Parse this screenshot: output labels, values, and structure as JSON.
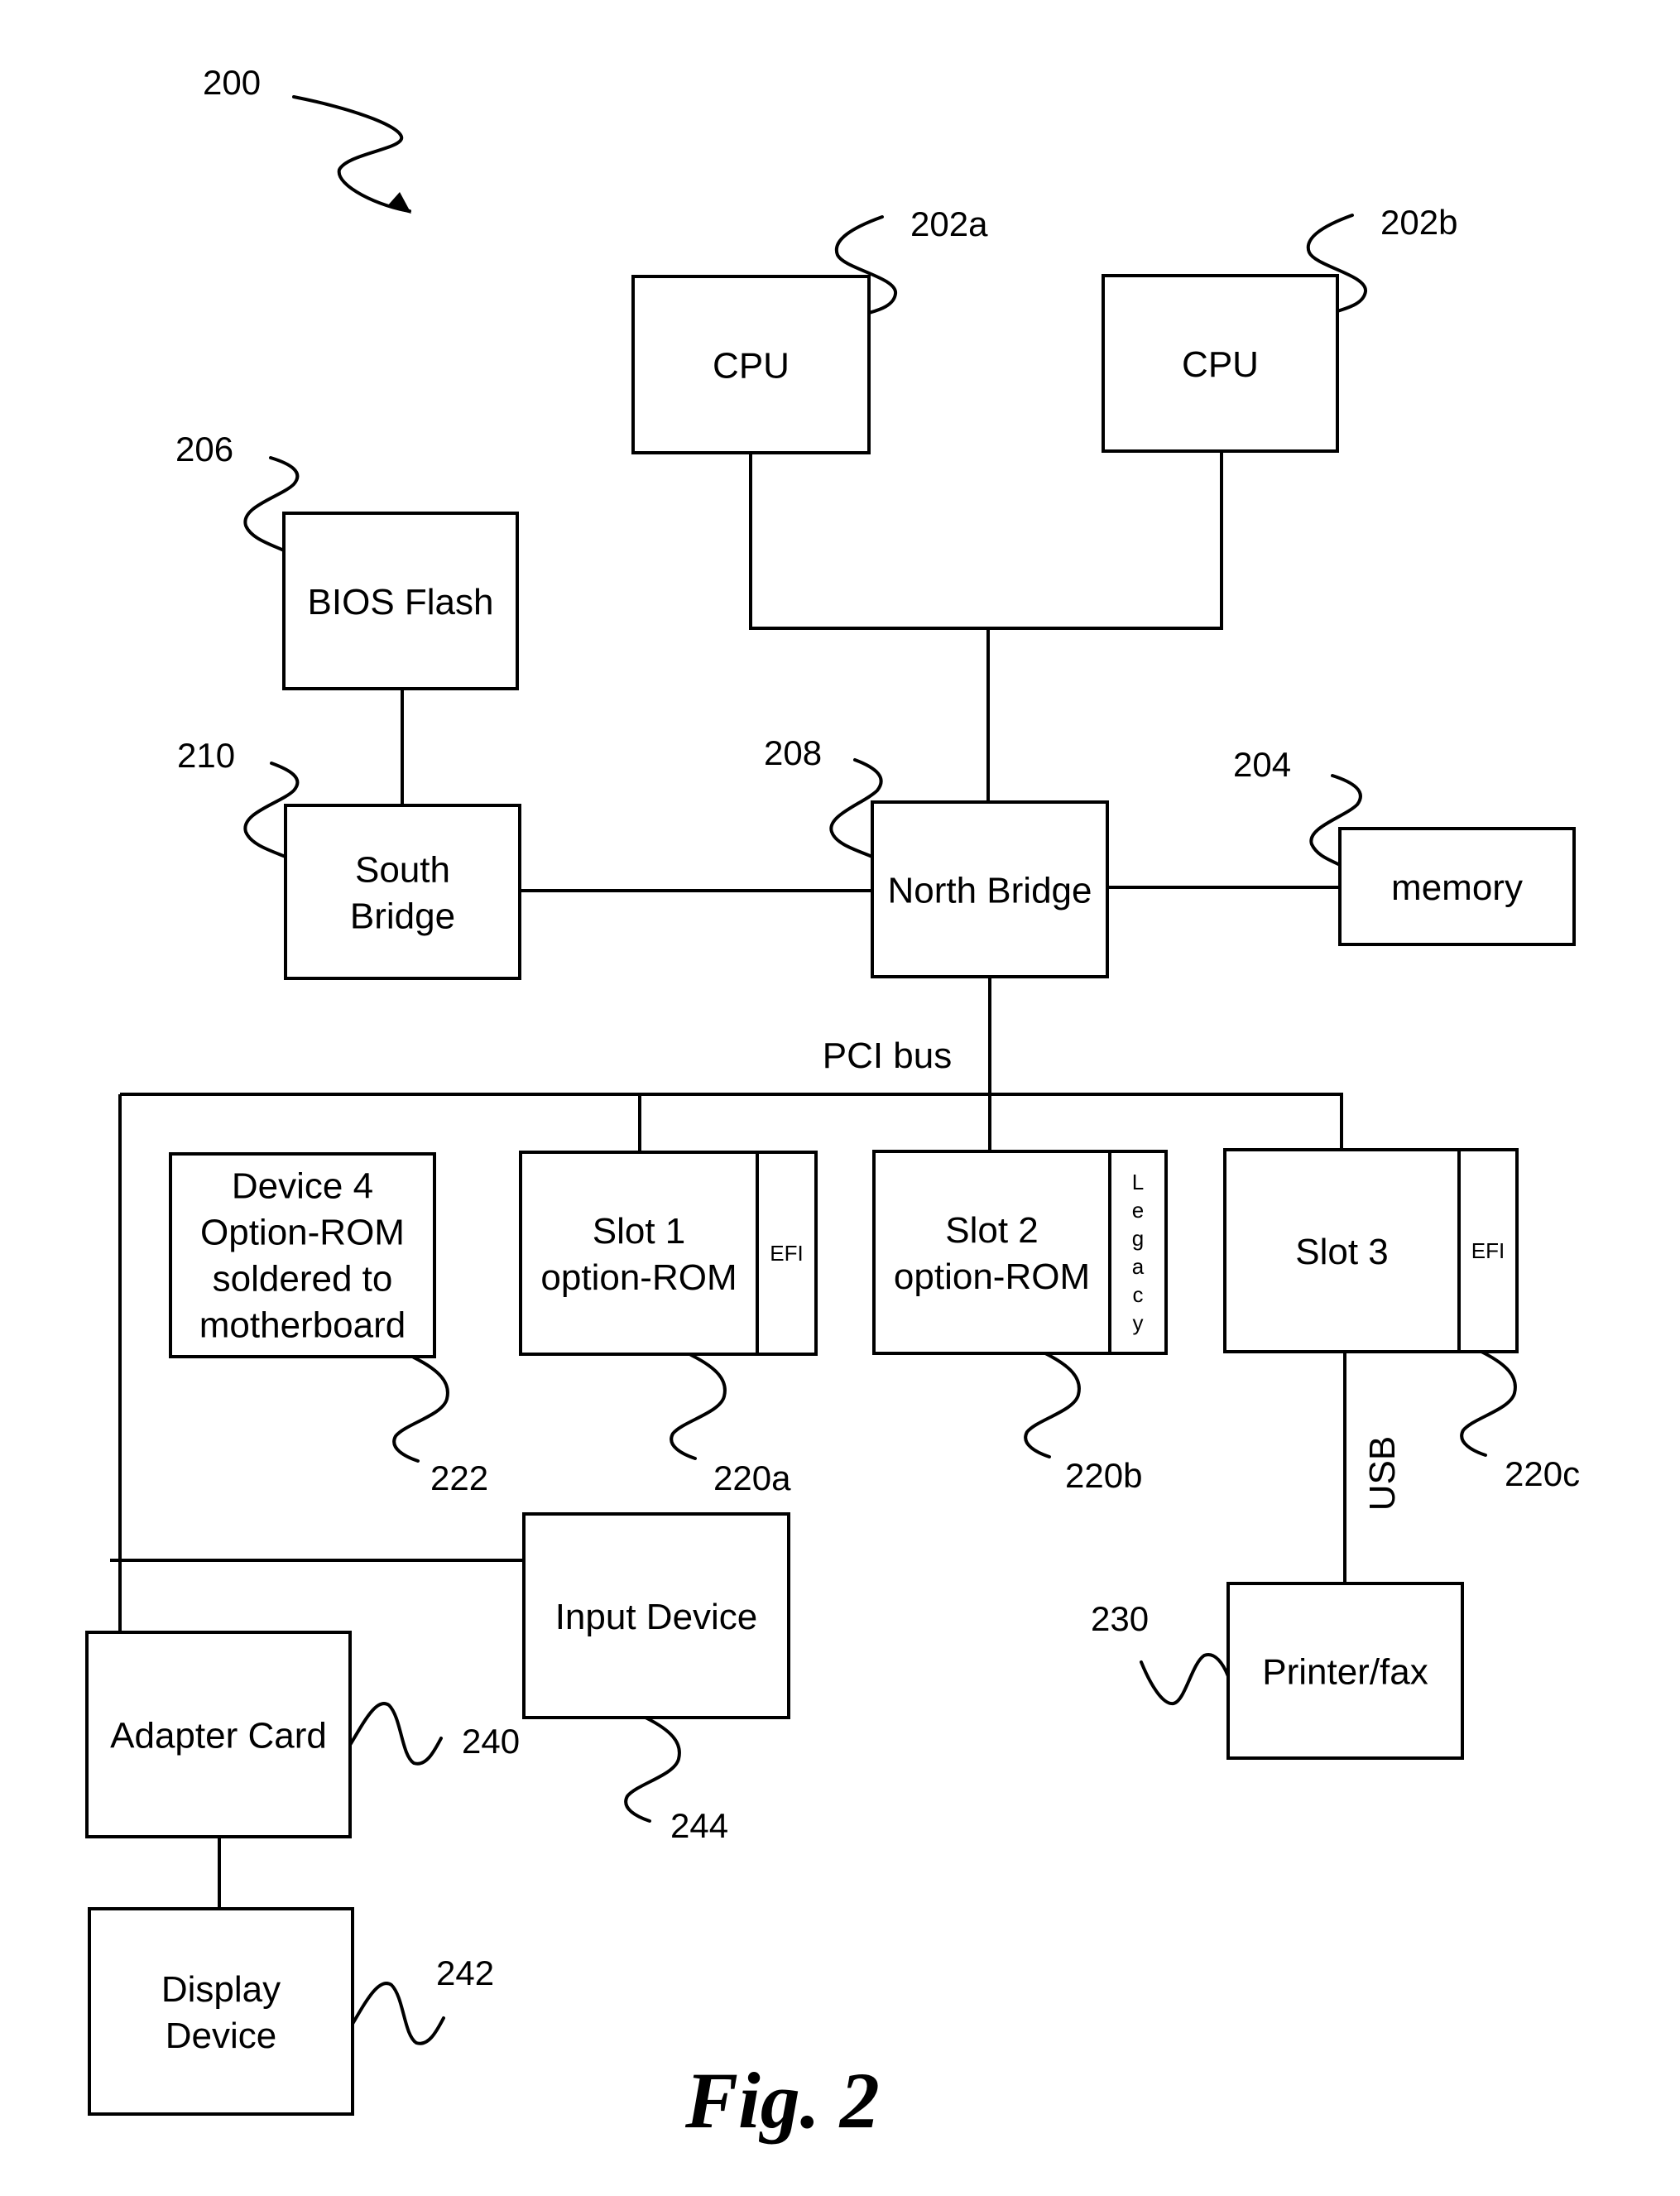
{
  "figure": {
    "figure_number_ref": "200",
    "caption": "Fig. 2"
  },
  "boxes": {
    "cpu_a": {
      "lines": [
        "CPU"
      ],
      "ref": "202a"
    },
    "cpu_b": {
      "lines": [
        "CPU"
      ],
      "ref": "202b"
    },
    "bios_flash": {
      "lines": [
        "BIOS Flash"
      ],
      "ref": "206"
    },
    "south_bridge": {
      "lines": [
        "South",
        "Bridge"
      ],
      "ref": "210"
    },
    "north_bridge": {
      "lines": [
        "North Bridge"
      ],
      "ref": "208"
    },
    "memory": {
      "lines": [
        "memory"
      ],
      "ref": "204"
    },
    "device4": {
      "lines": [
        "Device 4",
        "Option-ROM",
        "soldered to",
        "motherboard"
      ],
      "ref": "222"
    },
    "slot1": {
      "lines": [
        "Slot 1",
        "option-ROM"
      ],
      "ref": "220a",
      "side_label": "EFI"
    },
    "slot2": {
      "lines": [
        "Slot 2",
        "option-ROM"
      ],
      "ref": "220b",
      "side_label": "Legacy"
    },
    "slot3": {
      "lines": [
        "Slot 3"
      ],
      "ref": "220c",
      "side_label": "EFI"
    },
    "input_device": {
      "lines": [
        "Input Device"
      ],
      "ref": "244"
    },
    "adapter_card": {
      "lines": [
        "Adapter Card"
      ],
      "ref": "240"
    },
    "display_device": {
      "lines": [
        "Display",
        "Device"
      ],
      "ref": "242"
    },
    "printer_fax": {
      "lines": [
        "Printer/fax"
      ],
      "ref": "230"
    }
  },
  "bus_labels": {
    "pci": "PCI bus",
    "usb": "USB"
  }
}
